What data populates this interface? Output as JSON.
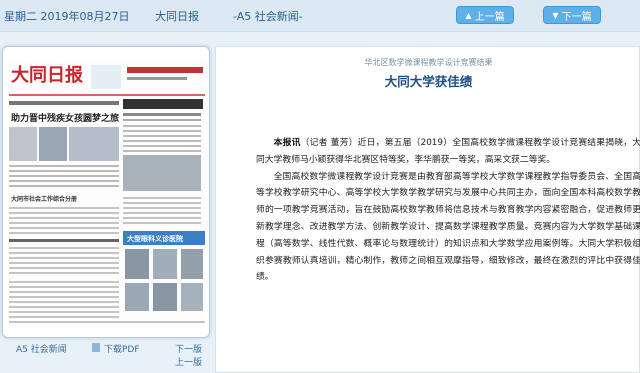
{
  "topbar": {
    "date": "星期二 2019年08月27日",
    "paper": "大同日报",
    "section": "-A5 社会新闻-",
    "prev_label": "上一篇",
    "next_label": "下一篇"
  },
  "thumbnail": {
    "masthead": "大同日报",
    "headlines": [
      "助力晋中残疾女孩圆梦之旅",
      "大同市社会工作综合分册",
      "大型眼科义诊医院"
    ]
  },
  "bottom_links": {
    "section": "A5 社会新闻",
    "pdf": "下载PDF",
    "next": "下一版",
    "prev": "上一版"
  },
  "article": {
    "subtitle": "华北区数学微课程教学设计竞赛结果",
    "title": "大同大学获佳绩",
    "lead": "本报讯",
    "p1_rest": "（记者 董芳）近日，第五届（2019）全国高校数学微课程教学设计竞赛结果揭晓，大同大学教师马小颖获得华北赛区特等奖，李华鹏获一等奖，高采文获二等奖。",
    "p2": "全国高校数学微课程教学设计竞赛是由教育部高等学校大学数学课程教学指导委员会、全国高等学校教学研究中心、高等学校大学数学教学研究与发展中心共同主办，面向全国本科高校数学教师的一项教学竞赛活动，旨在鼓励高校数学教师将信息技术与教育教学内容紧密融合，促进教师更新教学理念、改进教学方法、创新教学设计、提高数学课程教学质量。竞赛内容为大学数学基础课程（高等数学、线性代数、概率论与数理统计）的知识点和大学数学应用案例等。大同大学积极组织参赛教师认真培训，精心制作，教师之间相互观摩指导，细致修改，最终在激烈的评比中获得佳绩。"
  }
}
